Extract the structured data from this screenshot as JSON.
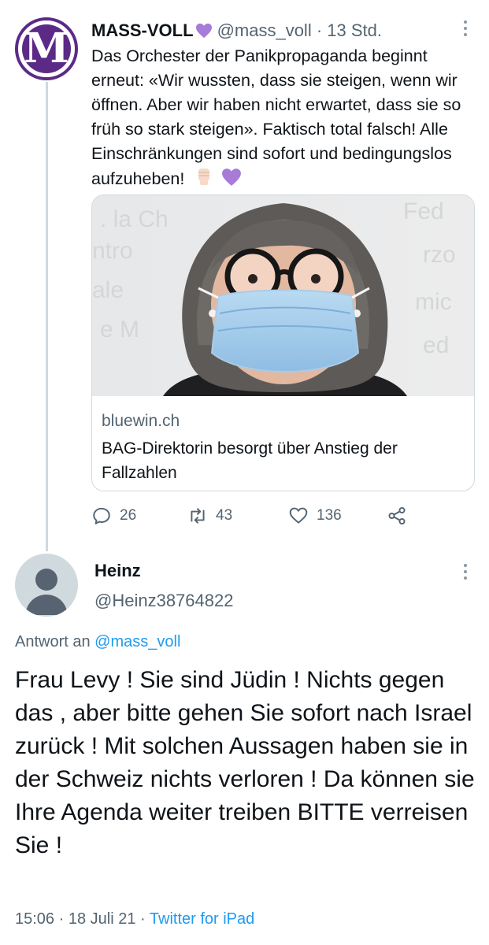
{
  "original_tweet": {
    "author_name": "MASS-VOLL",
    "author_handle": "@mass_voll",
    "time": "13 Std.",
    "avatar_letter": "M",
    "text": "Das Orchester der Panikpropaganda beginnt erneut: «Wir wussten, dass sie steigen, wenn wir öffnen. Aber wir haben nicht erwartet, dass sie so früh so stark steigen». Faktisch total falsch! Alle Einschränkungen sind sofort und bedingungslos aufzuheben!",
    "trailing_emojis": [
      "raised-fist-emoji",
      "purple-heart-emoji"
    ],
    "link_card": {
      "domain": "bluewin.ch",
      "title": "BAG-Direktorin besorgt über Anstieg der Fallzahlen"
    },
    "actions": {
      "replies": "26",
      "retweets": "43",
      "likes": "136"
    }
  },
  "reply_tweet": {
    "author_name": "Heinz",
    "author_handle": "@Heinz38764822",
    "reply_prefix": "Antwort an",
    "reply_mention": "@mass_voll",
    "text": "Frau Levy ! Sie sind Jüdin ! Nichts gegen das , aber bitte gehen Sie sofort nach Israel zurück ! Mit solchen Aussagen haben sie  in der Schweiz nichts verloren ! Da können sie Ihre Agenda weiter treiben BITTE verreisen Sie !",
    "time": "15:06",
    "date": "18 Juli 21",
    "source": "Twitter for iPad"
  },
  "colors": {
    "text": "#0f1419",
    "muted": "#536471",
    "link": "#1d9bf0",
    "border": "#cfd9de",
    "brand_purple": "#5b2a86"
  }
}
